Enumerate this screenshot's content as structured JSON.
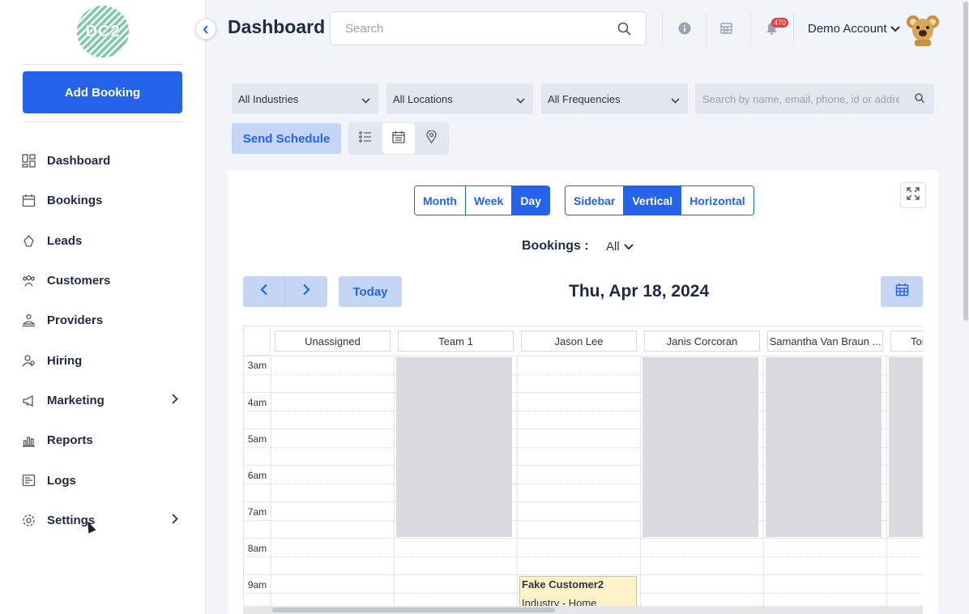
{
  "sidebar": {
    "logo_text": "DC2",
    "add_booking": "Add Booking",
    "items": [
      {
        "label": "Dashboard",
        "icon": "dashboard-icon"
      },
      {
        "label": "Bookings",
        "icon": "calendar-icon"
      },
      {
        "label": "Leads",
        "icon": "leads-icon"
      },
      {
        "label": "Customers",
        "icon": "customers-icon"
      },
      {
        "label": "Providers",
        "icon": "providers-icon"
      },
      {
        "label": "Hiring",
        "icon": "hiring-icon"
      },
      {
        "label": "Marketing",
        "icon": "megaphone-icon"
      },
      {
        "label": "Reports",
        "icon": "reports-icon"
      },
      {
        "label": "Logs",
        "icon": "logs-icon"
      },
      {
        "label": "Settings",
        "icon": "gear-icon"
      }
    ]
  },
  "header": {
    "title": "Dashboard",
    "search_placeholder": "Search",
    "notification_count": "470",
    "account_name": "Demo Account"
  },
  "filters": {
    "industries": "All Industries",
    "locations": "All Locations",
    "frequencies": "All Frequencies",
    "search_placeholder": "Search by name, email, phone, id or address",
    "send_schedule": "Send Schedule"
  },
  "calendar": {
    "range_tabs": [
      "Month",
      "Week",
      "Day"
    ],
    "active_range": "Day",
    "layout_tabs": [
      "Sidebar",
      "Vertical",
      "Horizontal"
    ],
    "active_layout": "Vertical",
    "bookings_label": "Bookings :",
    "bookings_value": "All",
    "today": "Today",
    "date": "Thu, Apr 18, 2024",
    "columns": [
      "Unassigned",
      "Team 1",
      "Jason Lee",
      "Janis Corcoran",
      "Samantha Van Braun ...",
      "Tom"
    ],
    "times": [
      "3am",
      "4am",
      "5am",
      "6am",
      "7am",
      "8am",
      "9am"
    ],
    "event": {
      "title": "Fake Customer2",
      "detail": "Industry - Home"
    }
  },
  "colors": {
    "accent": "#2563eb",
    "accent_light": "#c5d5f6",
    "blocked": "#d8dadf",
    "event_bg": "#fdf2c7"
  }
}
